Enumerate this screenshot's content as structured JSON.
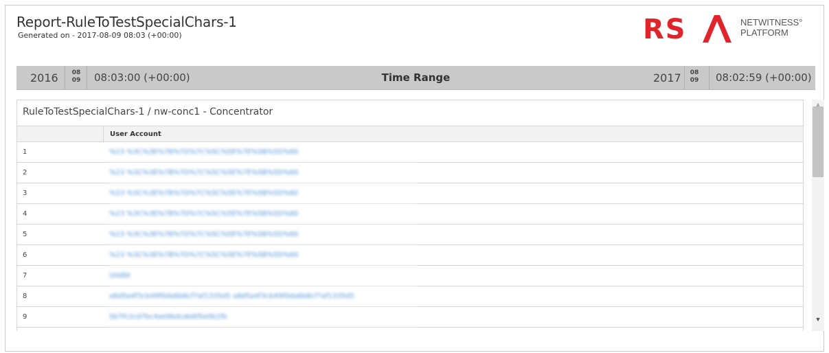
{
  "header": {
    "title": "Report-RuleToTestSpecialChars-1",
    "generated": "Generated on - 2017-08-09 08:03 (+00:00)"
  },
  "logo": {
    "letters": "RSA",
    "line1": "NETWITNESS°",
    "line2": "PLATFORM",
    "accent_color": "#e1242b"
  },
  "time_range": {
    "label": "Time Range",
    "start": {
      "year": "2016",
      "month": "08",
      "day": "09",
      "time": "08:03:00 (+00:00)"
    },
    "end": {
      "year": "2017",
      "month": "08",
      "day": "09",
      "time": "08:02:59 (+00:00)"
    }
  },
  "panel": {
    "title": "RuleToTestSpecialChars-1 / nw-conc1 - Concentrator",
    "column": "User Account",
    "rows": [
      {
        "num": "1",
        "value": "%23 %3C%3E%7B%7D%7C%5C%5E%7E%5B%5D%60"
      },
      {
        "num": "2",
        "value": "%23 %3C%3E%7B%7D%7C%5C%5E%7E%5B%5D%60"
      },
      {
        "num": "3",
        "value": "%23 %3C%3E%7B%7D%7C%5C%5E%7E%5B%5D%60"
      },
      {
        "num": "4",
        "value": "%23 %3C%3E%7B%7D%7C%5C%5E%7E%5B%5D%60"
      },
      {
        "num": "5",
        "value": "%23 %3C%3E%7B%7D%7C%5C%5E%7E%5B%5D%60"
      },
      {
        "num": "6",
        "value": "%23 %3C%3E%7B%7D%7C%5C%5E%7E%5B%5D%60"
      },
      {
        "num": "7",
        "value": "üöäßé"
      },
      {
        "num": "8",
        "value": "a8d5a4f3cb49f0da6b8cf7af1335d5 a8d5a4f3cb49f0da6b8cf7af1335d5"
      },
      {
        "num": "9",
        "value": "5b7fc2cd7bc4ae9bdcde6f5e0b1fb"
      }
    ]
  }
}
